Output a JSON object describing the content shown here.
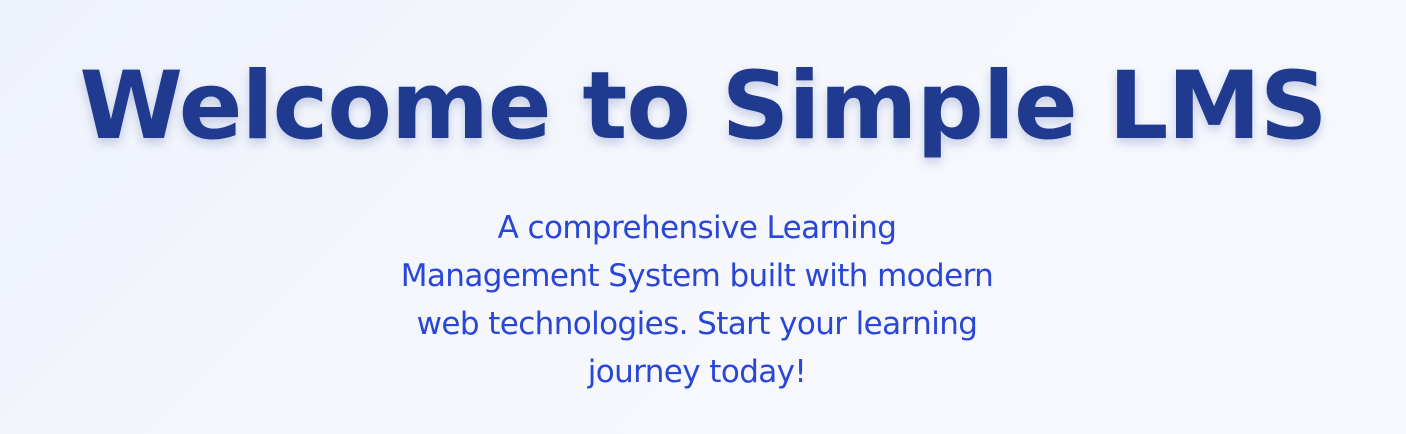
{
  "hero": {
    "title": "Welcome to Simple LMS",
    "subtitle": "A comprehensive Learning Management System built with modern web technologies. Start your learning journey today!"
  },
  "colors": {
    "title": "#1f3a8f",
    "subtitle": "#2946d6",
    "background": "#f3f6fd"
  }
}
